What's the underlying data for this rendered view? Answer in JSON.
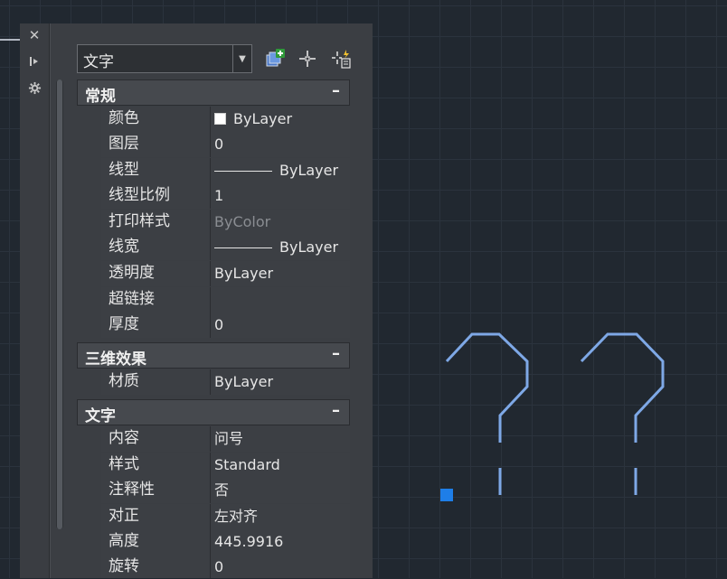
{
  "palette": {
    "title": "文字",
    "selector": {
      "value": "文字"
    },
    "toolbar": {
      "add_icon": "add-selection-icon",
      "pick_icon": "select-objects-icon",
      "quick_select_icon": "quick-select-icon"
    },
    "strip": {
      "close_icon": "close-icon",
      "autohide_icon": "autohide-icon",
      "settings_icon": "settings-icon"
    },
    "sections": {
      "general": {
        "title": "常规",
        "toggle": "–",
        "rows": [
          {
            "label": "颜色",
            "value": "ByLayer",
            "swatch": "#ffffff"
          },
          {
            "label": "图层",
            "value": "0"
          },
          {
            "label": "线型",
            "value": "ByLayer"
          },
          {
            "label": "线型比例",
            "value": "1"
          },
          {
            "label": "打印样式",
            "value": "ByColor"
          },
          {
            "label": "线宽",
            "value": "ByLayer"
          },
          {
            "label": "透明度",
            "value": "ByLayer"
          },
          {
            "label": "超链接",
            "value": ""
          },
          {
            "label": "厚度",
            "value": "0"
          }
        ]
      },
      "three_d": {
        "title": "三维效果",
        "toggle": "–",
        "rows": [
          {
            "label": "材质",
            "value": "ByLayer"
          }
        ]
      },
      "text": {
        "title": "文字",
        "toggle": "–",
        "rows": [
          {
            "label": "内容",
            "value": "问号"
          },
          {
            "label": "样式",
            "value": "Standard"
          },
          {
            "label": "注释性",
            "value": "否"
          },
          {
            "label": "对正",
            "value": "左对齐"
          },
          {
            "label": "高度",
            "value": "445.9916"
          },
          {
            "label": "旋转",
            "value": "0"
          }
        ]
      }
    }
  },
  "colors": {
    "canvas_bg": "#212830",
    "grid_line": "#2b333d",
    "text_geometry": "#7ea8e6",
    "grip": "#1e7ee8"
  }
}
